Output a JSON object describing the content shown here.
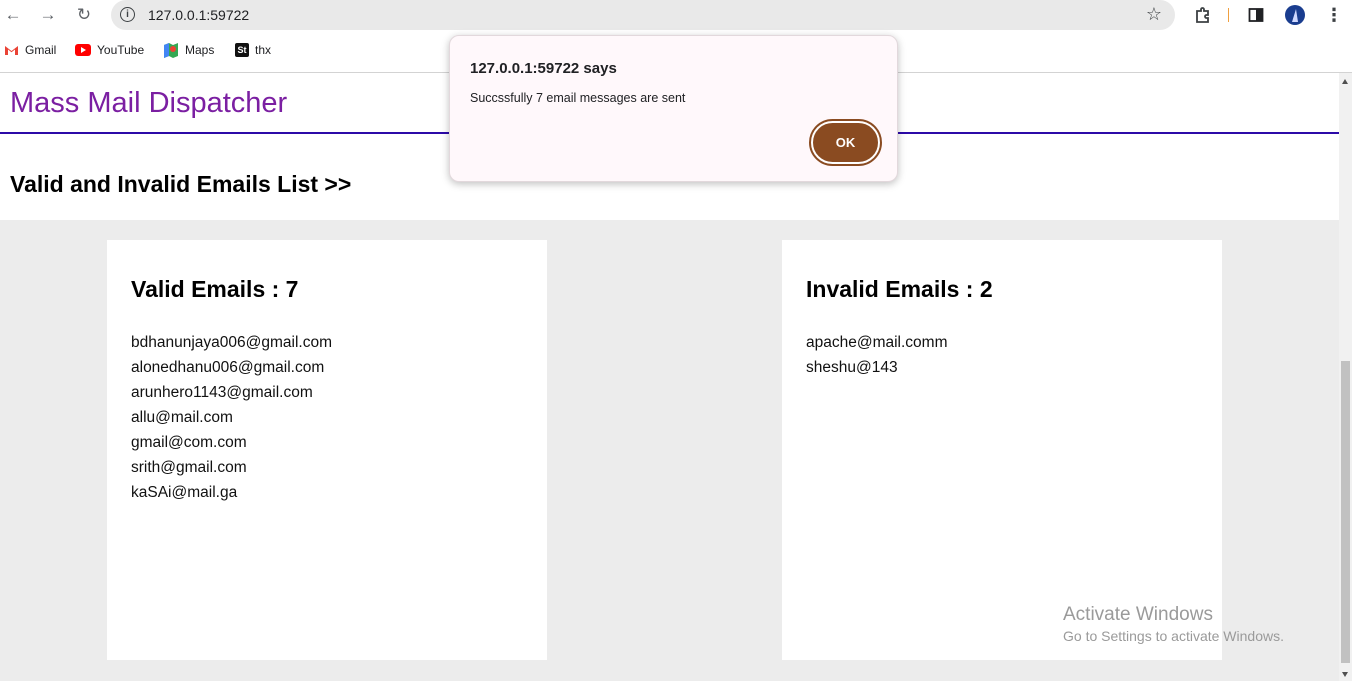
{
  "browser": {
    "url": "127.0.0.1:59722",
    "bookmarks": [
      {
        "label": "Gmail",
        "icon": "gmail-icon"
      },
      {
        "label": "YouTube",
        "icon": "youtube-icon"
      },
      {
        "label": "Maps",
        "icon": "maps-icon"
      },
      {
        "label": "thx",
        "icon": "st-icon"
      }
    ]
  },
  "header": {
    "title": "Mass Mail Dispatcher",
    "accent": "#7b1fa2",
    "rule_color": "#2c0aa8"
  },
  "subheader": {
    "title": "Valid and Invalid Emails List >>"
  },
  "valid": {
    "heading": "Valid Emails : 7",
    "emails": [
      "bdhanunjaya006@gmail.com",
      "alonedhanu006@gmail.com",
      "arunhero1143@gmail.com",
      "allu@mail.com",
      "gmail@com.com",
      "srith@gmail.com",
      "kaSAi@mail.ga"
    ]
  },
  "invalid": {
    "heading": "Invalid Emails : 2",
    "emails": [
      "apache@mail.comm",
      "sheshu@143"
    ]
  },
  "dialog": {
    "title": "127.0.0.1:59722 says",
    "message": "Succssfully 7 email messages are sent",
    "ok_label": "OK",
    "button_color": "#8a4b21"
  },
  "watermark": {
    "line1": "Activate Windows",
    "line2": "Go to Settings to activate Windows."
  }
}
